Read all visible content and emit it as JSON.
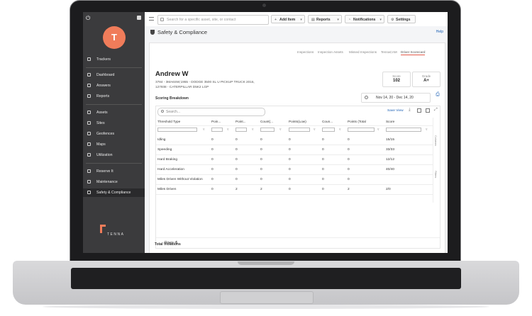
{
  "topbar": {
    "search_placeholder": "Search for a specific asset, site, or contact",
    "buttons": [
      {
        "label": "Add Item",
        "icon": "plus-icon"
      },
      {
        "label": "Reports",
        "icon": "chart-icon"
      },
      {
        "label": "Notifications",
        "icon": "bell-icon"
      },
      {
        "label": "Settings",
        "icon": "gear-icon"
      }
    ]
  },
  "sidebar": {
    "avatar_initial": "T",
    "items": [
      {
        "label": "Trackers",
        "icon": "gps-icon"
      },
      {
        "label": "Dashboard",
        "icon": "dashboard-icon"
      },
      {
        "label": "Answers",
        "icon": "answers-icon"
      },
      {
        "label": "Reports",
        "icon": "reports-icon"
      },
      {
        "label": "Assets",
        "icon": "assets-icon"
      },
      {
        "label": "Sites",
        "icon": "pin-icon"
      },
      {
        "label": "Geofences",
        "icon": "geofence-icon"
      },
      {
        "label": "Maps",
        "icon": "map-icon"
      },
      {
        "label": "Utilization",
        "icon": "utilization-icon"
      },
      {
        "label": "Reserve It",
        "icon": "reserve-icon"
      },
      {
        "label": "Maintenance",
        "icon": "wrench-icon"
      },
      {
        "label": "Safety & Compliance",
        "icon": "shield-icon"
      }
    ],
    "logo_text": "TENNA"
  },
  "page": {
    "title": "Safety & Compliance",
    "help": "Help"
  },
  "tabs": [
    "Inspections",
    "Inspection Assets",
    "Missed Inspections",
    "TennaCAM",
    "Driver Scorecard"
  ],
  "driver": {
    "name": "Andrew W",
    "line1": "3784 - 3MA6SW;1955 - DODGE 3500 SL U PICKUP TRUCK 2016,",
    "line2": "127938 - CATERPILLAR D5K2 LGP",
    "score_label": "Score",
    "score_value": "102",
    "grade_label": "Grade",
    "grade_value": "A+"
  },
  "breakdown": {
    "title": "Scoring Breakdown",
    "date_range": "Nov 14, 20 - Dec 14, 20",
    "search_placeholder": "Search...",
    "save_view": "Save View",
    "columns": [
      "Threshold Type",
      "Poin...",
      "Point...",
      "Count(...",
      "Points(Low)",
      "Coun...",
      "Points (Total",
      "Score"
    ],
    "rows": [
      [
        "Idling",
        "0",
        "0",
        "0",
        "0",
        "0",
        "0",
        "15/15"
      ],
      [
        "Speeding",
        "0",
        "0",
        "0",
        "0",
        "0",
        "0",
        "33/33"
      ],
      [
        "Hard Braking",
        "0",
        "0",
        "0",
        "0",
        "0",
        "0",
        "12/12"
      ],
      [
        "Hard Acceleration",
        "0",
        "0",
        "0",
        "0",
        "0",
        "0",
        "40/40"
      ],
      [
        "Miles Driven Without Violation",
        "0",
        "0",
        "0",
        "0",
        "0",
        "0",
        ""
      ],
      [
        "Miles Driven",
        "0",
        "2",
        "2",
        "0",
        "0",
        "2",
        "2/0"
      ]
    ],
    "side_labels": [
      "Columns",
      "Filters"
    ],
    "rows_label": "Rows:",
    "rows_count": "6"
  },
  "total_violations": "Total Violations"
}
